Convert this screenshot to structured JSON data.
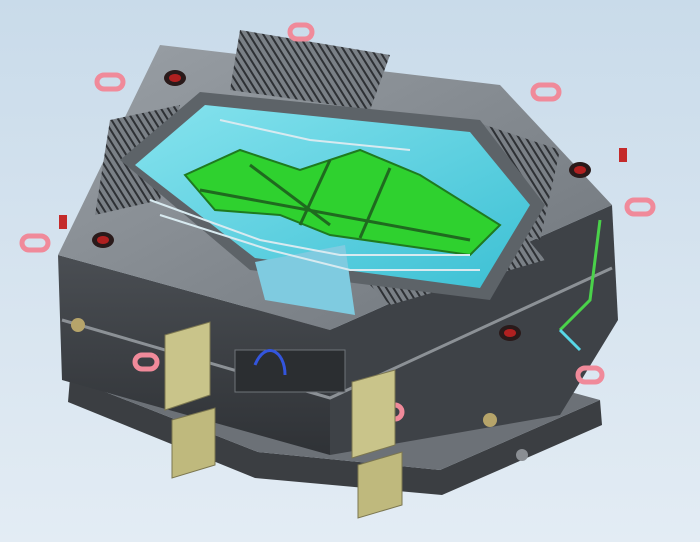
{
  "scene": {
    "subject": "",
    "palette": {
      "bg_top": "#c9dbea",
      "bg_bottom": "#dfe9f2",
      "steel_top": "#8f9499",
      "steel_dark": "#55595d",
      "steel_side": "#3c3f43",
      "steel_light": "#b7bcc1",
      "cavity": "#69d7e6",
      "cavity_deep": "#2db7cc",
      "part_green": "#2fd12f",
      "cooling": "#d9e9ee",
      "lifting_ring": "#f08a9a",
      "support_block": "#c9c48a",
      "hole_red": "#b02020"
    }
  }
}
